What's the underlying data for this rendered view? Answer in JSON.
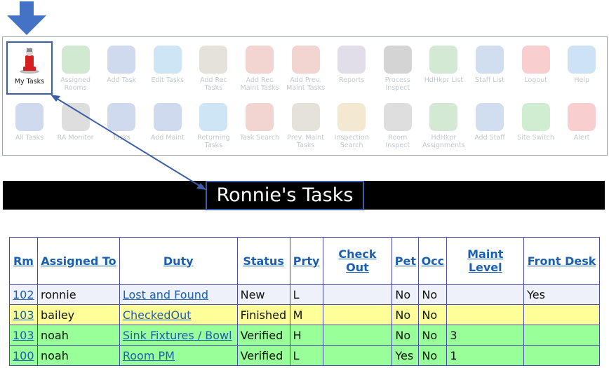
{
  "toolbar": {
    "row1": [
      {
        "label": "My Tasks",
        "icon": "my-tasks-icon",
        "active": true,
        "color": "#d62020"
      },
      {
        "label": "Assigned Rooms",
        "icon": "assigned-rooms-icon",
        "color": "#2e9b2e"
      },
      {
        "label": "Add Task",
        "icon": "add-task-icon",
        "color": "#2a57b8"
      },
      {
        "label": "Edit Tasks",
        "icon": "edit-tasks-icon",
        "color": "#1f8ad6"
      },
      {
        "label": "Add Rec\nTasks",
        "icon": "add-rec-tasks-icon",
        "color": "#8a7a55"
      },
      {
        "label": "Add Rec\nMaint Tasks",
        "icon": "add-rec-maint-tasks-icon",
        "color": "#c23a2a"
      },
      {
        "label": "Add Prev.\nMaint Tasks",
        "icon": "add-prev-maint-tasks-icon",
        "color": "#c23a2a"
      },
      {
        "label": "Reports",
        "icon": "reports-icon",
        "color": "#7a6a9a"
      },
      {
        "label": "Process\nInspect",
        "icon": "process-inspect-icon",
        "color": "#3a3a3a"
      },
      {
        "label": "HdHkpr List",
        "icon": "hdhkpr-list-icon",
        "color": "#3a9a3a"
      },
      {
        "label": "Staff List",
        "icon": "staff-list-icon",
        "color": "#2a6ab8"
      },
      {
        "label": "Logout",
        "icon": "logout-icon",
        "color": "#e02020"
      },
      {
        "label": "Help",
        "icon": "help-icon",
        "color": "#1f7ad6"
      }
    ],
    "row2": [
      {
        "label": "All Tasks",
        "icon": "all-tasks-icon",
        "color": "#2a57b8"
      },
      {
        "label": "RA Monitor",
        "icon": "ra-monitor-icon",
        "color": "#6a6a6a"
      },
      {
        "label": "Tasks",
        "icon": "tasks-icon",
        "color": "#2a57b8"
      },
      {
        "label": "Add Maint",
        "icon": "add-maint-icon",
        "color": "#2a57b8"
      },
      {
        "label": "Returning\nTasks",
        "icon": "returning-tasks-icon",
        "color": "#1f8ad6"
      },
      {
        "label": "Task Search",
        "icon": "task-search-icon",
        "color": "#c23a2a"
      },
      {
        "label": "Prev. Maint\nTasks",
        "icon": "prev-maint-tasks-icon",
        "color": "#8a7a55"
      },
      {
        "label": "Inspection\nSearch",
        "icon": "inspection-search-icon",
        "color": "#c29a2a"
      },
      {
        "label": "Room\nInspect",
        "icon": "room-inspect-icon",
        "color": "#6a6a6a"
      },
      {
        "label": "HdHkpr\nAssignments",
        "icon": "hdhkpr-assignments-icon",
        "color": "#3a9a3a"
      },
      {
        "label": "Add Staff",
        "icon": "add-staff-icon",
        "color": "#2a6ab8"
      },
      {
        "label": "Site Switch",
        "icon": "site-switch-icon",
        "color": "#2eae2e"
      },
      {
        "label": "Alert",
        "icon": "alert-icon",
        "color": "#e02020"
      }
    ]
  },
  "title": "Ronnie's Tasks",
  "table": {
    "headers": [
      "Rm",
      "Assigned To",
      "Duty",
      "Status",
      "Prty",
      "Check Out",
      "Pet",
      "Occ",
      "Maint Level",
      "Front Desk"
    ],
    "rows": [
      {
        "rm": "102",
        "assigned": "ronnie",
        "duty": "Lost and Found",
        "status": "New",
        "prty": "L",
        "checkout": "",
        "pet": "No",
        "occ": "No",
        "maint": "",
        "frontdesk": "Yes"
      },
      {
        "rm": "103",
        "assigned": "bailey",
        "duty": "CheckedOut",
        "status": "Finished",
        "prty": "M",
        "checkout": "",
        "pet": "No",
        "occ": "No",
        "maint": "",
        "frontdesk": ""
      },
      {
        "rm": "103",
        "assigned": "noah",
        "duty": "Sink Fixtures / Bowl",
        "status": "Verified",
        "prty": "H",
        "checkout": "",
        "pet": "No",
        "occ": "No",
        "maint": "3",
        "frontdesk": ""
      },
      {
        "rm": "100",
        "assigned": "noah",
        "duty": "Room PM",
        "status": "Verified",
        "prty": "L",
        "checkout": "",
        "pet": "Yes",
        "occ": "No",
        "maint": "1",
        "frontdesk": ""
      }
    ]
  },
  "colors": {
    "accent": "#3b5ea8",
    "link": "#1b5fb0",
    "row_new": "#eef1fa",
    "row_finished": "#ffff99",
    "row_verified": "#99ff99"
  }
}
